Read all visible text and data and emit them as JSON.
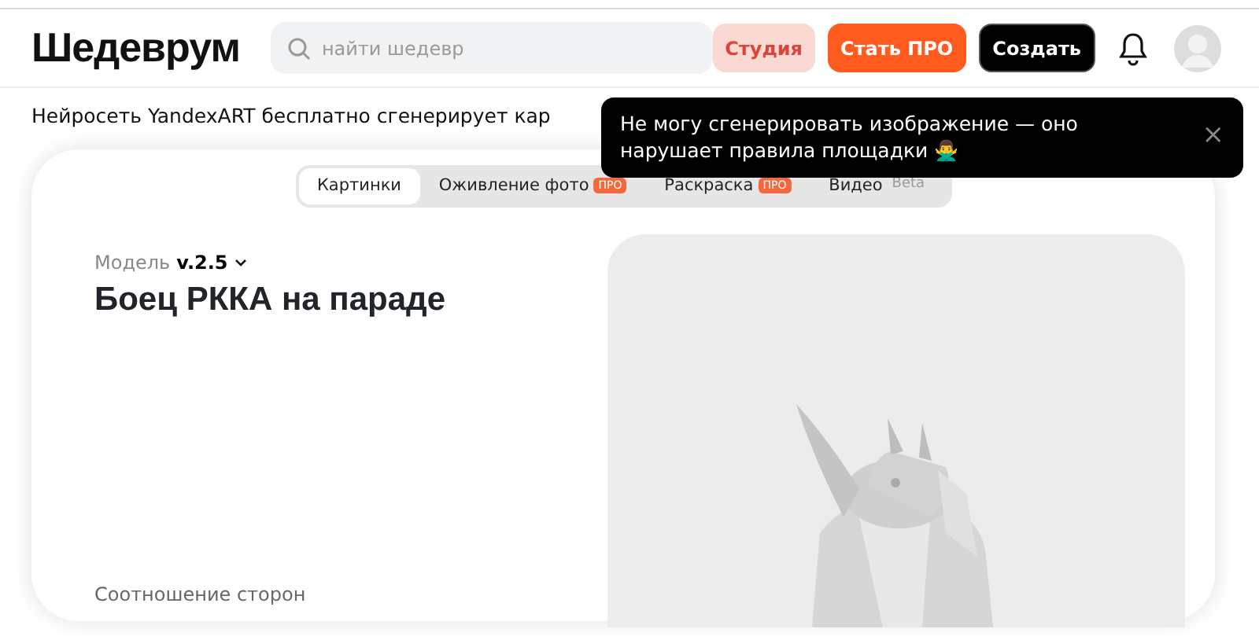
{
  "header": {
    "logo": "Шедеврум",
    "search": {
      "placeholder": "найти шедевр"
    },
    "buttons": [
      {
        "label": "Студия",
        "kind": "soft"
      },
      {
        "label": "Стать ПРО",
        "kind": "accent"
      },
      {
        "label": "Создать",
        "kind": "dark"
      }
    ]
  },
  "tagline": "Нейросеть YandexART бесплатно сгенерирует кар",
  "toast": {
    "text": "Не могу сгенерировать изображение — оно нарушает правила площадки 🙅‍♂️",
    "close": "×"
  },
  "tabs": [
    {
      "label": "Картинки",
      "selected": true
    },
    {
      "label": "Оживление фото",
      "selected": false,
      "badge": "ПРО",
      "badge_filled": true
    },
    {
      "label": "Раскраска",
      "selected": false,
      "badge": "ПРО",
      "badge_filled": true
    },
    {
      "label": "Видео",
      "selected": false,
      "badge": "Beta",
      "badge_filled": false
    }
  ],
  "model": {
    "label": "Модель",
    "value": "v.2.5"
  },
  "prompt": "Боец РККА на параде",
  "aspect_label": "Соотношение сторон"
}
